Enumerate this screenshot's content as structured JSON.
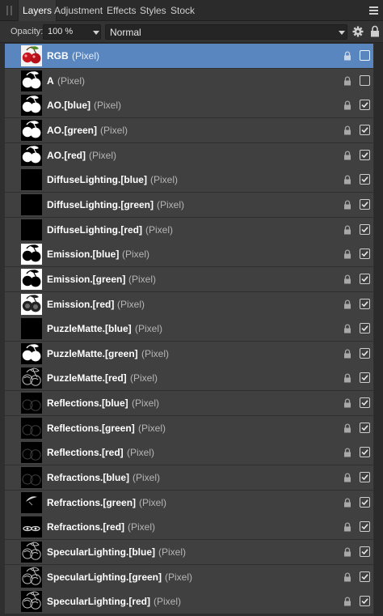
{
  "tabs": [
    {
      "label": "Layers",
      "active": true
    },
    {
      "label": "Adjustment",
      "active": false
    },
    {
      "label": "Effects",
      "active": false
    },
    {
      "label": "Styles",
      "active": false
    },
    {
      "label": "Stock",
      "active": false
    }
  ],
  "panel_menu_icon": "hamburger-menu-icon",
  "toolbar": {
    "opacity_label": "Opacity:",
    "opacity_value": "100 %",
    "blend_mode": "Normal",
    "settings_icon": "gear-icon",
    "lock_icon": "lock-icon"
  },
  "colors": {
    "selection": "#5a86c0",
    "row": "#404040",
    "panel": "#2e2e2e"
  },
  "layers": [
    {
      "name": "RGB",
      "type": "(Pixel)",
      "thumb": "cherries-color",
      "visible": false,
      "selected": true
    },
    {
      "name": "A",
      "type": "(Pixel)",
      "thumb": "cherries-mask",
      "visible": false,
      "selected": false
    },
    {
      "name": "AO.[blue]",
      "type": "(Pixel)",
      "thumb": "cherries-mask",
      "visible": true,
      "selected": false
    },
    {
      "name": "AO.[green]",
      "type": "(Pixel)",
      "thumb": "cherries-mask",
      "visible": true,
      "selected": false
    },
    {
      "name": "AO.[red]",
      "type": "(Pixel)",
      "thumb": "cherries-mask",
      "visible": true,
      "selected": false
    },
    {
      "name": "DiffuseLighting.[blue]",
      "type": "(Pixel)",
      "thumb": "black",
      "visible": true,
      "selected": false
    },
    {
      "name": "DiffuseLighting.[green]",
      "type": "(Pixel)",
      "thumb": "black",
      "visible": true,
      "selected": false
    },
    {
      "name": "DiffuseLighting.[red]",
      "type": "(Pixel)",
      "thumb": "black",
      "visible": true,
      "selected": false
    },
    {
      "name": "Emission.[blue]",
      "type": "(Pixel)",
      "thumb": "cherries-inverse",
      "visible": true,
      "selected": false
    },
    {
      "name": "Emission.[green]",
      "type": "(Pixel)",
      "thumb": "cherries-inverse",
      "visible": true,
      "selected": false
    },
    {
      "name": "Emission.[red]",
      "type": "(Pixel)",
      "thumb": "cherries-inverse-gray",
      "visible": true,
      "selected": false
    },
    {
      "name": "PuzzleMatte.[blue]",
      "type": "(Pixel)",
      "thumb": "black",
      "visible": true,
      "selected": false
    },
    {
      "name": "PuzzleMatte.[green]",
      "type": "(Pixel)",
      "thumb": "cherries-mask",
      "visible": true,
      "selected": false
    },
    {
      "name": "PuzzleMatte.[red]",
      "type": "(Pixel)",
      "thumb": "cherries-outline",
      "visible": true,
      "selected": false
    },
    {
      "name": "Reflections.[blue]",
      "type": "(Pixel)",
      "thumb": "cherries-faint",
      "visible": true,
      "selected": false
    },
    {
      "name": "Reflections.[green]",
      "type": "(Pixel)",
      "thumb": "cherries-faint",
      "visible": true,
      "selected": false
    },
    {
      "name": "Reflections.[red]",
      "type": "(Pixel)",
      "thumb": "cherries-faint",
      "visible": true,
      "selected": false
    },
    {
      "name": "Refractions.[blue]",
      "type": "(Pixel)",
      "thumb": "cherries-faint",
      "visible": true,
      "selected": false
    },
    {
      "name": "Refractions.[green]",
      "type": "(Pixel)",
      "thumb": "cherries-leaf",
      "visible": true,
      "selected": false
    },
    {
      "name": "Refractions.[red]",
      "type": "(Pixel)",
      "thumb": "cherries-highlight",
      "visible": true,
      "selected": false
    },
    {
      "name": "SpecularLighting.[blue]",
      "type": "(Pixel)",
      "thumb": "cherries-outline",
      "visible": true,
      "selected": false
    },
    {
      "name": "SpecularLighting.[green]",
      "type": "(Pixel)",
      "thumb": "cherries-outline",
      "visible": true,
      "selected": false
    },
    {
      "name": "SpecularLighting.[red]",
      "type": "(Pixel)",
      "thumb": "cherries-outline",
      "visible": true,
      "selected": false
    }
  ]
}
